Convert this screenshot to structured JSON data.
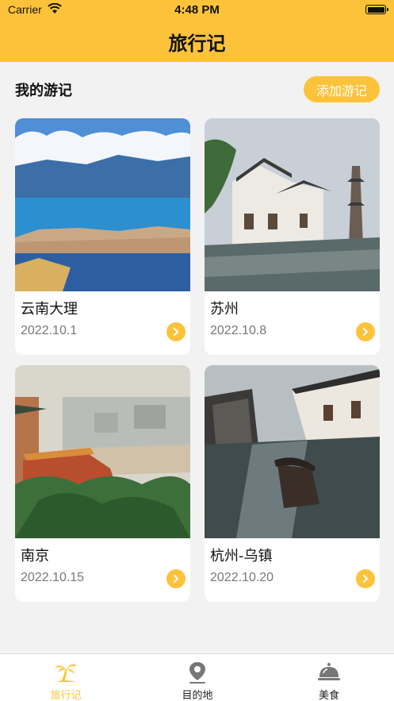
{
  "status_bar": {
    "carrier": "Carrier",
    "time": "4:48 PM"
  },
  "nav": {
    "title": "旅行记"
  },
  "section": {
    "title": "我的游记",
    "add_button": "添加游记"
  },
  "journals": [
    {
      "name": "云南大理",
      "date": "2022.10.1"
    },
    {
      "name": "苏州",
      "date": "2022.10.8"
    },
    {
      "name": "南京",
      "date": "2022.10.15"
    },
    {
      "name": "杭州-乌镇",
      "date": "2022.10.20"
    }
  ],
  "tabs": [
    {
      "label": "旅行记",
      "icon": "palm-tree-icon",
      "active": true
    },
    {
      "label": "目的地",
      "icon": "location-pin-icon",
      "active": false
    },
    {
      "label": "美食",
      "icon": "food-cloche-icon",
      "active": false
    }
  ],
  "colors": {
    "accent": "#fcc33a",
    "background": "#f2f2f2"
  }
}
